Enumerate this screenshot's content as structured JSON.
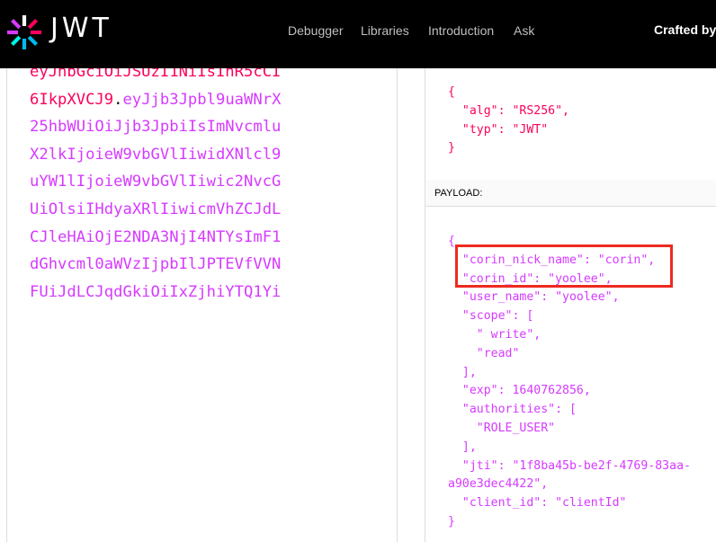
{
  "brand": {
    "logo_text": "JWT"
  },
  "nav": {
    "items": [
      "Debugger",
      "Libraries",
      "Introduction",
      "Ask"
    ],
    "crafted_by": "Crafted by"
  },
  "encoded": {
    "lines": [
      [
        {
          "t": "eyJhbGciOiJSUzI1NiIsInR5cCI",
          "c": "red"
        }
      ],
      [
        {
          "t": "6IkpXVCJ9",
          "c": "red"
        },
        {
          "t": ".",
          "c": "dot"
        },
        {
          "t": "eyJjb3Jpbl9uaWNrX",
          "c": "purple"
        }
      ],
      [
        {
          "t": "25hbWUiOiJjb3JpbiIsImNvcmlu",
          "c": "purple"
        }
      ],
      [
        {
          "t": "X2lkIjoieW9vbGVlIiwidXNlcl9",
          "c": "purple"
        }
      ],
      [
        {
          "t": "uYW1lIjoieW9vbGVlIiwic2NvcG",
          "c": "purple"
        }
      ],
      [
        {
          "t": "UiOlsiIHdyaXRlIiwicmVhZCJdL",
          "c": "purple"
        }
      ],
      [
        {
          "t": "CJleHAiOjE2NDA3NjI4NTYsImF1",
          "c": "purple"
        }
      ],
      [
        {
          "t": "dGhvcml0aWVzIjpbIlJPTEVfVVN",
          "c": "purple"
        }
      ],
      [
        {
          "t": "FUiJdLCJqdGkiOiIxZjhiYTQ1Yi",
          "c": "purple"
        }
      ]
    ]
  },
  "header_section": {
    "lines": [
      "{",
      "  \"alg\": \"RS256\",",
      "  \"typ\": \"JWT\"",
      "}"
    ]
  },
  "payload_section": {
    "label": "PAYLOAD:",
    "lines": [
      "{",
      "  \"corin_nick_name\": \"corin\",",
      "  \"corin_id\": \"yoolee\",",
      "  \"user_name\": \"yoolee\",",
      "  \"scope\": [",
      "    \" write\",",
      "    \"read\"",
      "  ],",
      "  \"exp\": 1640762856,",
      "  \"authorities\": [",
      "    \"ROLE_USER\"",
      "  ],",
      "  \"jti\": \"1f8ba45b-be2f-4769-83aa-",
      "a90e3dec4422\",",
      "  \"client_id\": \"clientId\"",
      "}"
    ]
  },
  "colors": {
    "header_red": "#fb015b",
    "payload_purple": "#d63aff",
    "highlight_border": "#ee2a1f",
    "topbar_bg": "#000000"
  },
  "icons": {
    "logo": "jwt-pinwheel-icon"
  }
}
